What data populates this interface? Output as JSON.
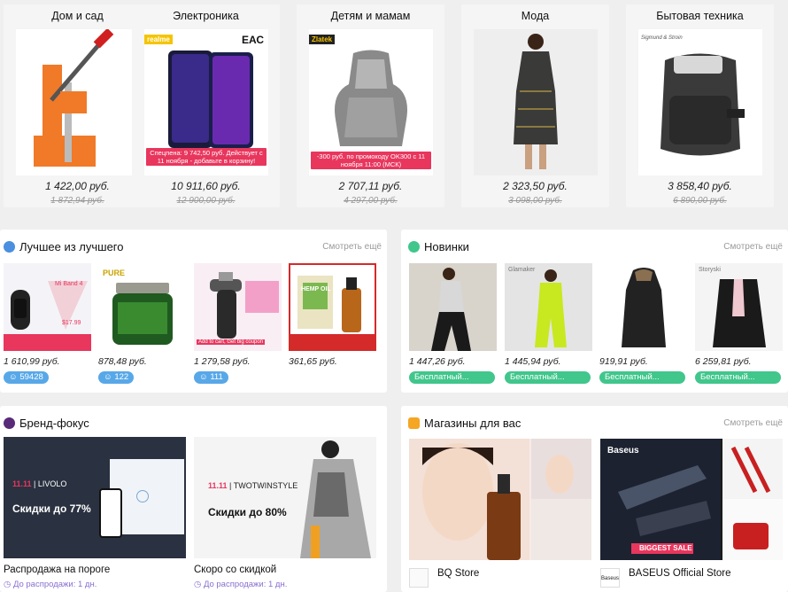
{
  "categories": [
    {
      "title": "Дом и сад",
      "price": "1 422,00 руб.",
      "old_price": "1 872,94 руб."
    },
    {
      "title": "Электроника",
      "price": "10 911,60 руб.",
      "old_price": "12 900,00 руб.",
      "brand": "realme",
      "brand2": "ЕАС",
      "promo": "Спецпена: 9 742,50 руб. Действует с 11 ноября - добавьте в корзину!"
    },
    {
      "title": "Детям и мамам",
      "price": "2 707,11 руб.",
      "old_price": "4 297,00 руб.",
      "brand": "Zlatek",
      "promo": "-300 руб. по промокоду OK300 с 11 ноября 11:00 (МСК)"
    },
    {
      "title": "Мода",
      "price": "2 323,50 руб.",
      "old_price": "3 098,00 руб."
    },
    {
      "title": "Бытовая техника",
      "price": "3 858,40 руб.",
      "old_price": "6 890,00 руб.",
      "brand": "Sigmund & Stroin"
    }
  ],
  "best": {
    "title": "Лучшее из лучшего",
    "more": "Смотреть ещё",
    "items": [
      {
        "price": "1 610,99 руб.",
        "count": "59428",
        "img_text": "Mi Band 4",
        "img_price": "$17.99"
      },
      {
        "price": "878,48 руб.",
        "count": "122",
        "img_text": "PURE"
      },
      {
        "price": "1 279,58 руб.",
        "count": "111",
        "img_text": "Add to cart, Get big coupon"
      },
      {
        "price": "361,65 руб.",
        "img_text": "HEMP OIL"
      }
    ]
  },
  "new": {
    "title": "Новинки",
    "more": "Смотреть ещё",
    "free_label": "Бесплатный...",
    "items": [
      {
        "price": "1 447,26 руб."
      },
      {
        "price": "1 445,94 руб.",
        "img_text": "Glamaker"
      },
      {
        "price": "919,91 руб."
      },
      {
        "price": "6 259,81 руб.",
        "img_text": "Storyski"
      }
    ]
  },
  "brands": {
    "title": "Бренд-фокус",
    "items": [
      {
        "label": "Распродажа на пороге",
        "sub": "До распродажи: 1 дн.",
        "logo": "LIVOLO",
        "discount": "Скидки до 77%"
      },
      {
        "label": "Скоро со скидкой",
        "sub": "До распродажи: 1 дн.",
        "logo": "TWOTWINSTYLE",
        "discount": "Скидки до 80%"
      }
    ]
  },
  "stores": {
    "title": "Магазины для вас",
    "more": "Смотреть ещё",
    "items": [
      {
        "name": "BQ Store"
      },
      {
        "name": "BASEUS Official Store",
        "logo": "Baseus",
        "img_text": "BIGGEST SALE"
      }
    ]
  },
  "colors": {
    "accent": "#e8365d",
    "badge": "#58a8e8",
    "free": "#41c68c",
    "best_icon": "#4a8fe0",
    "new_icon": "#41c68c",
    "brand_icon": "#5a2a7a",
    "store_icon": "#f5a623"
  }
}
